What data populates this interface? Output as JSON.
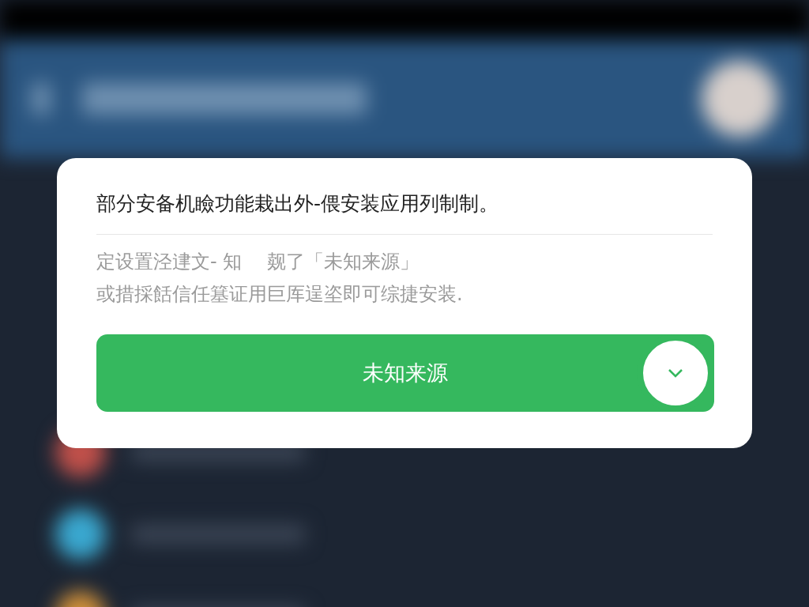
{
  "dialog": {
    "title": "部分安备机瞼功能栽出外-偎安装应用列制制。",
    "message_lines": [
      "定设置泾䢖文- 知　 觌了「未知来源」",
      "或措採餂信任簊证用巨厍逞垐即可综捷安装."
    ],
    "button": {
      "label": "未知来源",
      "checked": false
    }
  }
}
